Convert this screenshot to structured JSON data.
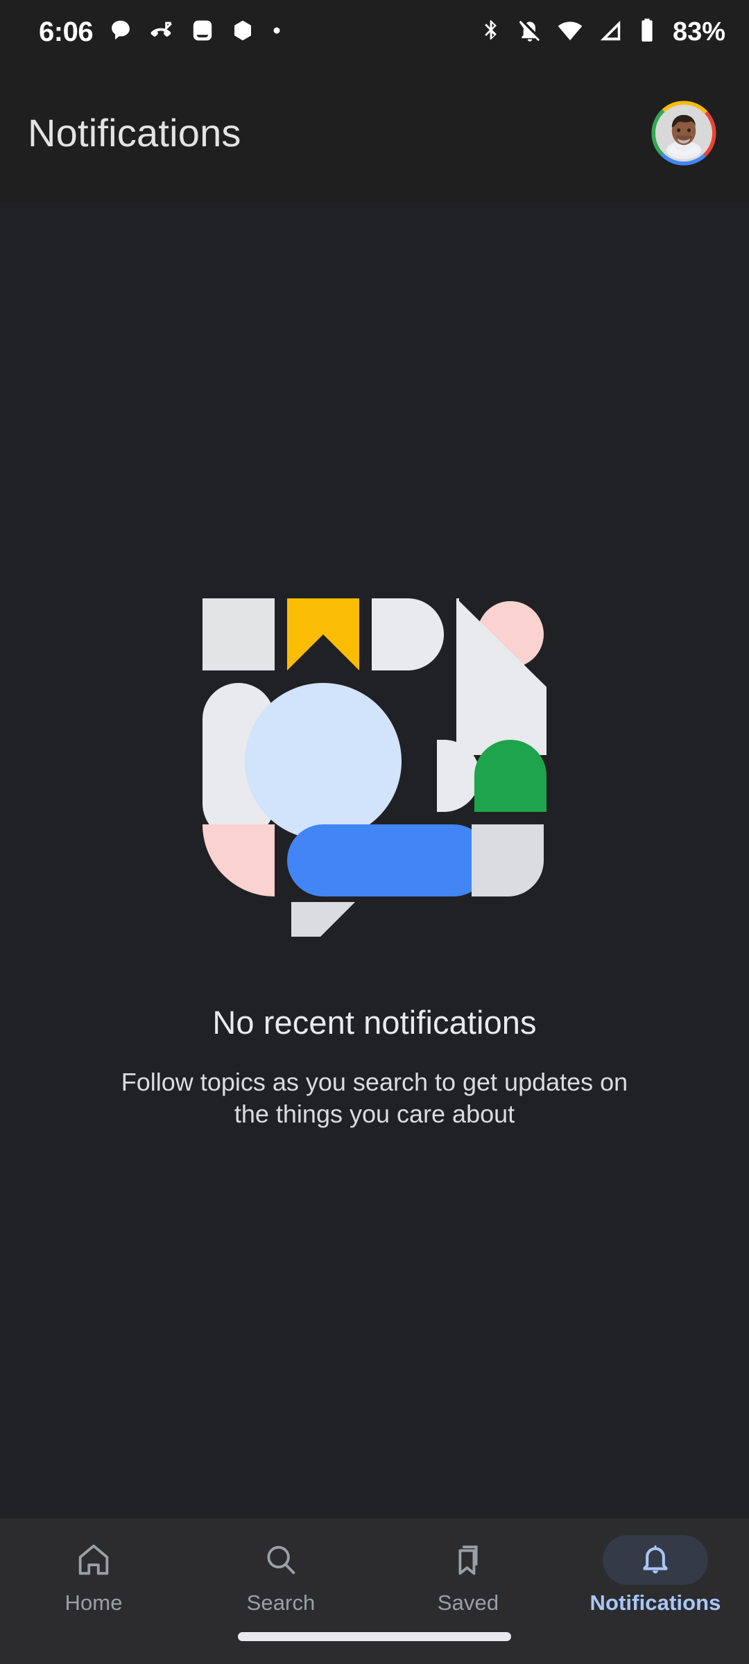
{
  "status_bar": {
    "time": "6:06",
    "battery_percent": "83%",
    "left_icons": [
      "chat-bubble-icon",
      "missed-call-icon",
      "app-notification-icon",
      "hexagon-icon",
      "dot-icon"
    ],
    "right_icons": [
      "bluetooth-icon",
      "ringer-vibrate-off-icon",
      "wifi-icon",
      "cellular-signal-icon",
      "battery-icon"
    ]
  },
  "header": {
    "title": "Notifications",
    "avatar_name": "account-avatar",
    "avatar_ring_colors": [
      "#ea4335",
      "#4285f4",
      "#34a853",
      "#fbbc04"
    ]
  },
  "empty_state": {
    "title": "No recent notifications",
    "subtitle": "Follow topics as you search to get updates on the things you care about",
    "illustration_name": "geometric-speech-bubble-illustration",
    "illustration_colors": {
      "grey": "#e3e4e6",
      "light_grey": "#dadce0",
      "yellow": "#fbbc04",
      "pink": "#fad2cf",
      "light_blue": "#d2e3fc",
      "blue": "#4285f4",
      "green": "#1ea44c"
    }
  },
  "bottom_nav": {
    "active_index": 3,
    "active_color": "#a8c7fa",
    "inactive_color": "#9aa0a6",
    "items": [
      {
        "label": "Home",
        "icon": "home-icon"
      },
      {
        "label": "Search",
        "icon": "search-icon"
      },
      {
        "label": "Saved",
        "icon": "bookmark-icon"
      },
      {
        "label": "Notifications",
        "icon": "bell-icon"
      }
    ]
  },
  "system": {
    "gesture_bar": "gesture-navigation-bar"
  },
  "colors": {
    "header_bg": "#1f1f1f",
    "content_bg": "#202124",
    "nav_bg": "#2c2c2e",
    "nav_active_pill": "#343a46"
  }
}
